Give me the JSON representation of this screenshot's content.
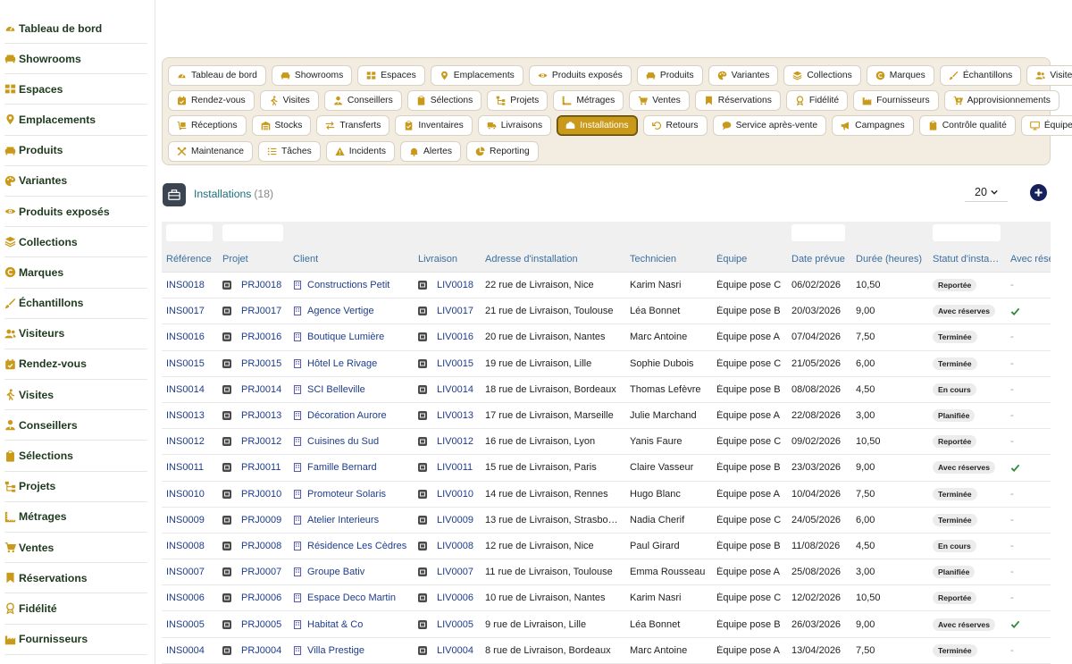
{
  "sidebar": {
    "items": [
      {
        "label": "Tableau de bord",
        "icon": "gauge-icon"
      },
      {
        "label": "Showrooms",
        "icon": "sofa-icon"
      },
      {
        "label": "Espaces",
        "icon": "grid-icon"
      },
      {
        "label": "Emplacements",
        "icon": "pin-icon"
      },
      {
        "label": "Produits",
        "icon": "sofa-icon"
      },
      {
        "label": "Variantes",
        "icon": "palette-icon"
      },
      {
        "label": "Produits exposés",
        "icon": "eye-icon"
      },
      {
        "label": "Collections",
        "icon": "layers-icon"
      },
      {
        "label": "Marques",
        "icon": "copyright-icon"
      },
      {
        "label": "Échantillons",
        "icon": "brush-icon"
      },
      {
        "label": "Visiteurs",
        "icon": "users-icon"
      },
      {
        "label": "Rendez-vous",
        "icon": "calendar-check-icon"
      },
      {
        "label": "Visites",
        "icon": "walking-icon"
      },
      {
        "label": "Conseillers",
        "icon": "user-tie-icon"
      },
      {
        "label": "Sélections",
        "icon": "clipboard-icon"
      },
      {
        "label": "Projets",
        "icon": "sitemap-icon"
      },
      {
        "label": "Métrages",
        "icon": "ruler-icon"
      },
      {
        "label": "Ventes",
        "icon": "cart-icon"
      },
      {
        "label": "Réservations",
        "icon": "bookmark-icon"
      },
      {
        "label": "Fidélité",
        "icon": "award-icon"
      },
      {
        "label": "Fournisseurs",
        "icon": "industry-icon"
      }
    ]
  },
  "chips": {
    "rows": [
      [
        {
          "label": "Tableau de bord",
          "icon": "gauge-icon"
        },
        {
          "label": "Showrooms",
          "icon": "sofa-icon"
        },
        {
          "label": "Espaces",
          "icon": "grid-icon"
        },
        {
          "label": "Emplacements",
          "icon": "pin-icon"
        },
        {
          "label": "Produits exposés",
          "icon": "eye-icon"
        },
        {
          "label": "Produits",
          "icon": "sofa-icon"
        },
        {
          "label": "Variantes",
          "icon": "palette-icon"
        },
        {
          "label": "Collections",
          "icon": "layers-icon"
        },
        {
          "label": "Marques",
          "icon": "copyright-icon"
        },
        {
          "label": "Échantillons",
          "icon": "brush-icon"
        },
        {
          "label": "Visiteurs",
          "icon": "users-icon"
        }
      ],
      [
        {
          "label": "Rendez-vous",
          "icon": "calendar-check-icon"
        },
        {
          "label": "Visites",
          "icon": "walking-icon"
        },
        {
          "label": "Conseillers",
          "icon": "user-tie-icon"
        },
        {
          "label": "Sélections",
          "icon": "clipboard-icon"
        },
        {
          "label": "Projets",
          "icon": "sitemap-icon"
        },
        {
          "label": "Métrages",
          "icon": "ruler-icon"
        },
        {
          "label": "Ventes",
          "icon": "cart-icon"
        },
        {
          "label": "Réservations",
          "icon": "bookmark-icon"
        },
        {
          "label": "Fidélité",
          "icon": "award-icon"
        },
        {
          "label": "Fournisseurs",
          "icon": "industry-icon"
        },
        {
          "label": "Approvisionnements",
          "icon": "cart-plus-icon"
        }
      ],
      [
        {
          "label": "Réceptions",
          "icon": "dolly-icon"
        },
        {
          "label": "Stocks",
          "icon": "warehouse-icon"
        },
        {
          "label": "Transferts",
          "icon": "exchange-icon"
        },
        {
          "label": "Inventaires",
          "icon": "clipboard-check-icon"
        },
        {
          "label": "Livraisons",
          "icon": "truck-icon"
        },
        {
          "label": "Installations",
          "icon": "tools-box-icon",
          "active": true
        },
        {
          "label": "Retours",
          "icon": "undo-icon"
        },
        {
          "label": "Service après-vente",
          "icon": "comment-icon"
        },
        {
          "label": "Campagnes",
          "icon": "bullhorn-icon"
        },
        {
          "label": "Contrôle qualité",
          "icon": "clipboard-icon"
        },
        {
          "label": "Équipements",
          "icon": "monitor-icon"
        }
      ],
      [
        {
          "label": "Maintenance",
          "icon": "wrench-icon"
        },
        {
          "label": "Tâches",
          "icon": "list-icon"
        },
        {
          "label": "Incidents",
          "icon": "warning-icon"
        },
        {
          "label": "Alertes",
          "icon": "bell-icon"
        },
        {
          "label": "Reporting",
          "icon": "pie-icon"
        }
      ]
    ]
  },
  "section": {
    "title": "Installations",
    "count": "(18)",
    "page_size": "20"
  },
  "table": {
    "columns": [
      "Référence",
      "Projet",
      "Client",
      "Livraison",
      "Adresse d'installation",
      "Technicien",
      "Équipe",
      "Date prévue",
      "Durée (heures)",
      "Statut d'insta…",
      "Avec rése"
    ],
    "rows": [
      {
        "ref": "INS0018",
        "proj": "PRJ0018",
        "client": "Constructions Petit",
        "liv": "LIV0018",
        "addr": "22 rue de Livraison, Nice",
        "tech": "Karim Nasri",
        "eq": "Équipe pose C",
        "date": "06/02/2026",
        "dur": "10,50",
        "stat": "Reportée",
        "res": "-"
      },
      {
        "ref": "INS0017",
        "proj": "PRJ0017",
        "client": "Agence Vertige",
        "liv": "LIV0017",
        "addr": "21 rue de Livraison, Toulouse",
        "tech": "Léa Bonnet",
        "eq": "Équipe pose B",
        "date": "20/03/2026",
        "dur": "9,00",
        "stat": "Avec réserves",
        "res": "check"
      },
      {
        "ref": "INS0016",
        "proj": "PRJ0016",
        "client": "Boutique Lumière",
        "liv": "LIV0016",
        "addr": "20 rue de Livraison, Nantes",
        "tech": "Marc Antoine",
        "eq": "Équipe pose A",
        "date": "07/04/2026",
        "dur": "7,50",
        "stat": "Terminée",
        "res": "-"
      },
      {
        "ref": "INS0015",
        "proj": "PRJ0015",
        "client": "Hôtel Le Rivage",
        "liv": "LIV0015",
        "addr": "19 rue de Livraison, Lille",
        "tech": "Sophie Dubois",
        "eq": "Équipe pose C",
        "date": "21/05/2026",
        "dur": "6,00",
        "stat": "Terminée",
        "res": "-"
      },
      {
        "ref": "INS0014",
        "proj": "PRJ0014",
        "client": "SCI Belleville",
        "liv": "LIV0014",
        "addr": "18 rue de Livraison, Bordeaux",
        "tech": "Thomas Lefèvre",
        "eq": "Équipe pose B",
        "date": "08/08/2026",
        "dur": "4,50",
        "stat": "En cours",
        "res": "-"
      },
      {
        "ref": "INS0013",
        "proj": "PRJ0013",
        "client": "Décoration Aurore",
        "liv": "LIV0013",
        "addr": "17 rue de Livraison, Marseille",
        "tech": "Julie Marchand",
        "eq": "Équipe pose A",
        "date": "22/08/2026",
        "dur": "3,00",
        "stat": "Planifiée",
        "res": "-"
      },
      {
        "ref": "INS0012",
        "proj": "PRJ0012",
        "client": "Cuisines du Sud",
        "liv": "LIV0012",
        "addr": "16 rue de Livraison, Lyon",
        "tech": "Yanis Faure",
        "eq": "Équipe pose C",
        "date": "09/02/2026",
        "dur": "10,50",
        "stat": "Reportée",
        "res": "-"
      },
      {
        "ref": "INS0011",
        "proj": "PRJ0011",
        "client": "Famille Bernard",
        "liv": "LIV0011",
        "addr": "15 rue de Livraison, Paris",
        "tech": "Claire Vasseur",
        "eq": "Équipe pose B",
        "date": "23/03/2026",
        "dur": "9,00",
        "stat": "Avec réserves",
        "res": "check"
      },
      {
        "ref": "INS0010",
        "proj": "PRJ0010",
        "client": "Promoteur Solaris",
        "liv": "LIV0010",
        "addr": "14 rue de Livraison, Rennes",
        "tech": "Hugo Blanc",
        "eq": "Équipe pose A",
        "date": "10/04/2026",
        "dur": "7,50",
        "stat": "Terminée",
        "res": "-"
      },
      {
        "ref": "INS0009",
        "proj": "PRJ0009",
        "client": "Atelier Interieurs",
        "liv": "LIV0009",
        "addr": "13 rue de Livraison, Strasbo…",
        "tech": "Nadia Cherif",
        "eq": "Équipe pose C",
        "date": "24/05/2026",
        "dur": "6,00",
        "stat": "Terminée",
        "res": "-"
      },
      {
        "ref": "INS0008",
        "proj": "PRJ0008",
        "client": "Résidence Les Cèdres",
        "liv": "LIV0008",
        "addr": "12 rue de Livraison, Nice",
        "tech": "Paul Girard",
        "eq": "Équipe pose B",
        "date": "11/08/2026",
        "dur": "4,50",
        "stat": "En cours",
        "res": "-"
      },
      {
        "ref": "INS0007",
        "proj": "PRJ0007",
        "client": "Groupe Bativ",
        "liv": "LIV0007",
        "addr": "11 rue de Livraison, Toulouse",
        "tech": "Emma Rousseau",
        "eq": "Équipe pose A",
        "date": "25/08/2026",
        "dur": "3,00",
        "stat": "Planifiée",
        "res": "-"
      },
      {
        "ref": "INS0006",
        "proj": "PRJ0006",
        "client": "Espace Deco Martin",
        "liv": "LIV0006",
        "addr": "10 rue de Livraison, Nantes",
        "tech": "Karim Nasri",
        "eq": "Équipe pose C",
        "date": "12/02/2026",
        "dur": "10,50",
        "stat": "Reportée",
        "res": "-"
      },
      {
        "ref": "INS0005",
        "proj": "PRJ0005",
        "client": "Habitat & Co",
        "liv": "LIV0005",
        "addr": "9 rue de Livraison, Lille",
        "tech": "Léa Bonnet",
        "eq": "Équipe pose B",
        "date": "26/03/2026",
        "dur": "9,00",
        "stat": "Avec réserves",
        "res": "check"
      },
      {
        "ref": "INS0004",
        "proj": "PRJ0004",
        "client": "Villa Prestige",
        "liv": "LIV0004",
        "addr": "8 rue de Livraison, Bordeaux",
        "tech": "Marc Antoine",
        "eq": "Équipe pose A",
        "date": "13/04/2026",
        "dur": "7,50",
        "stat": "Terminée",
        "res": "-"
      }
    ]
  },
  "colors": {
    "accent_gold": "#c99a1a",
    "panel_bg": "#f3ede1",
    "link_blue": "#1e3c8a",
    "sidebar_icon": "#c99a1a",
    "check_green": "#2e8b3d"
  }
}
